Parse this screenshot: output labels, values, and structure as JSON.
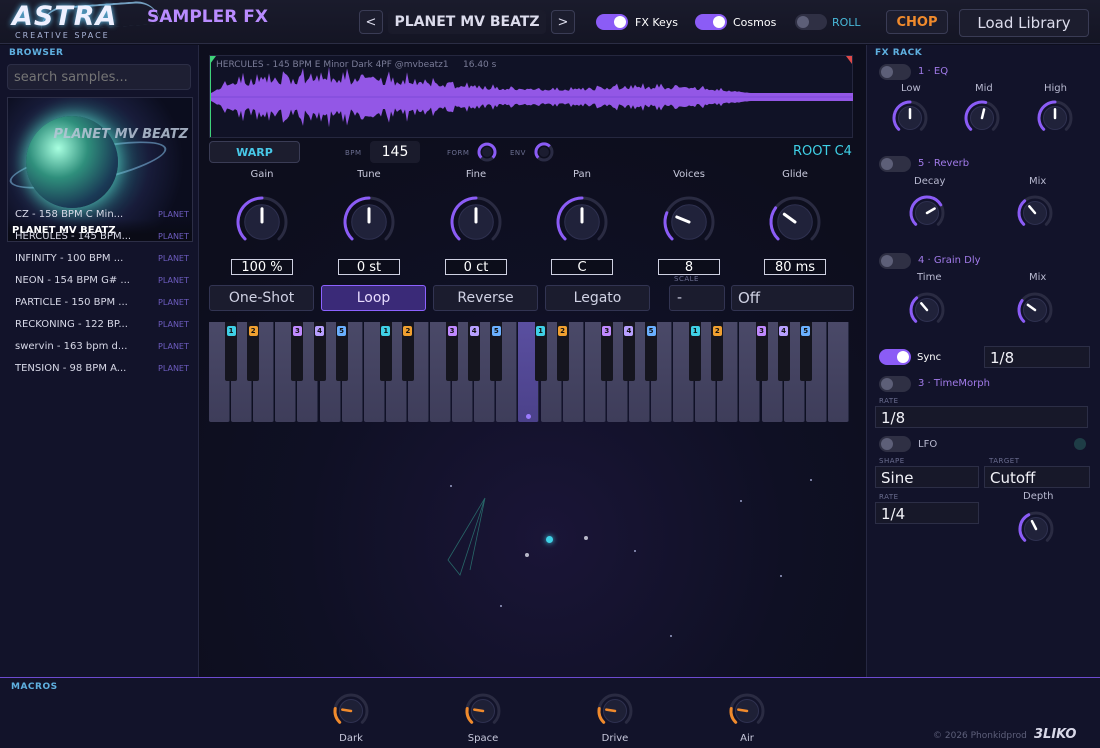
{
  "header": {
    "logo": "ASTRA",
    "logo_sub": "CREATIVE SPACE",
    "app_title": "SAMPLER FX",
    "preset_prev": "<",
    "preset_name": "PLANET MV BEATZ",
    "preset_next": ">",
    "toggles": [
      {
        "label": "FX Keys",
        "on": true
      },
      {
        "label": "Cosmos",
        "on": true
      },
      {
        "label": "ROLL",
        "on": false
      }
    ],
    "chop_label": "CHOP",
    "load_library_label": "Load Library"
  },
  "browser": {
    "title": "BROWSER",
    "search_placeholder": "search samples...",
    "cover_caption": "PLANET MV BEATZ",
    "cover_art_text": "PLANET MV BEATZ",
    "items": [
      {
        "name": "CZ - 158 BPM C Min...",
        "tag": "PLANET"
      },
      {
        "name": "HERCULES - 145 BPM...",
        "tag": "PLANET"
      },
      {
        "name": "INFINITY - 100 BPM ...",
        "tag": "PLANET"
      },
      {
        "name": "NEON - 154 BPM G# ...",
        "tag": "PLANET"
      },
      {
        "name": "PARTICLE - 150 BPM ...",
        "tag": "PLANET"
      },
      {
        "name": "RECKONING - 122 BP...",
        "tag": "PLANET"
      },
      {
        "name": "swervin - 163 bpm d...",
        "tag": "PLANET"
      },
      {
        "name": "TENSION - 98 BPM A...",
        "tag": "PLANET"
      }
    ]
  },
  "sampler": {
    "wave_label": "HERCULES - 145 BPM E Minor Dark 4PF @mvbeatz1",
    "wave_length": "16.40 s",
    "warp_label": "WARP",
    "bpm_caption": "BPM",
    "bpm_value": "145",
    "form_caption": "FORM",
    "env_caption": "ENV",
    "root_label": "ROOT C4",
    "knobs": [
      {
        "label": "Gain",
        "value": "100 %",
        "level": 0.5
      },
      {
        "label": "Tune",
        "value": "0 st",
        "level": 0.5
      },
      {
        "label": "Fine",
        "value": "0 ct",
        "level": 0.5
      },
      {
        "label": "Pan",
        "value": "C",
        "level": 0.5
      },
      {
        "label": "Voices",
        "value": "8",
        "level": 0.25
      },
      {
        "label": "Glide",
        "value": "80 ms",
        "level": 0.3
      }
    ],
    "modes": [
      {
        "label": "One-Shot",
        "active": false
      },
      {
        "label": "Loop",
        "active": true
      },
      {
        "label": "Reverse",
        "active": false
      },
      {
        "label": "Legato",
        "active": false
      }
    ],
    "scale_caption": "SCALE",
    "scale_value": "-",
    "scale_mode": "Off",
    "badges": [
      "1",
      "2",
      "3",
      "4",
      "5"
    ]
  },
  "fx_rack": {
    "title": "FX RACK",
    "eq": {
      "title": "1 · EQ",
      "knobs": [
        {
          "label": "Low",
          "level": 0.5
        },
        {
          "label": "Mid",
          "level": 0.55
        },
        {
          "label": "High",
          "level": 0.5
        }
      ]
    },
    "reverb": {
      "title": "5 · Reverb",
      "knobs": [
        {
          "label": "Decay",
          "level": 0.72
        },
        {
          "label": "Mix",
          "level": 0.35
        }
      ]
    },
    "grain": {
      "title": "4 · Grain Dly",
      "knobs": [
        {
          "label": "Time",
          "level": 0.35
        },
        {
          "label": "Mix",
          "level": 0.3
        }
      ]
    },
    "sync_label": "Sync",
    "sync_value": "1/8",
    "timemorph": {
      "title": "3 · TimeMorph",
      "rate_caption": "RATE",
      "rate_value": "1/8"
    },
    "lfo": {
      "title": "LFO",
      "shape_caption": "SHAPE",
      "shape_value": "Sine",
      "target_caption": "TARGET",
      "target_value": "Cutoff",
      "rate_caption": "RATE",
      "rate_value": "1/4",
      "depth_label": "Depth",
      "depth_level": 0.4
    }
  },
  "macros": {
    "title": "MACROS",
    "knobs": [
      {
        "label": "Dark",
        "level": 0.2
      },
      {
        "label": "Space",
        "level": 0.2
      },
      {
        "label": "Drive",
        "level": 0.2
      },
      {
        "label": "Air",
        "level": 0.2
      }
    ]
  },
  "footer": {
    "copyright": "© 2026 Phonkidprod",
    "brand": "3LIKO"
  },
  "colors": {
    "accent": "#8b5cf6",
    "cyan": "#3fd0e6",
    "orange": "#f08a2c",
    "lilac": "#b98cff"
  }
}
